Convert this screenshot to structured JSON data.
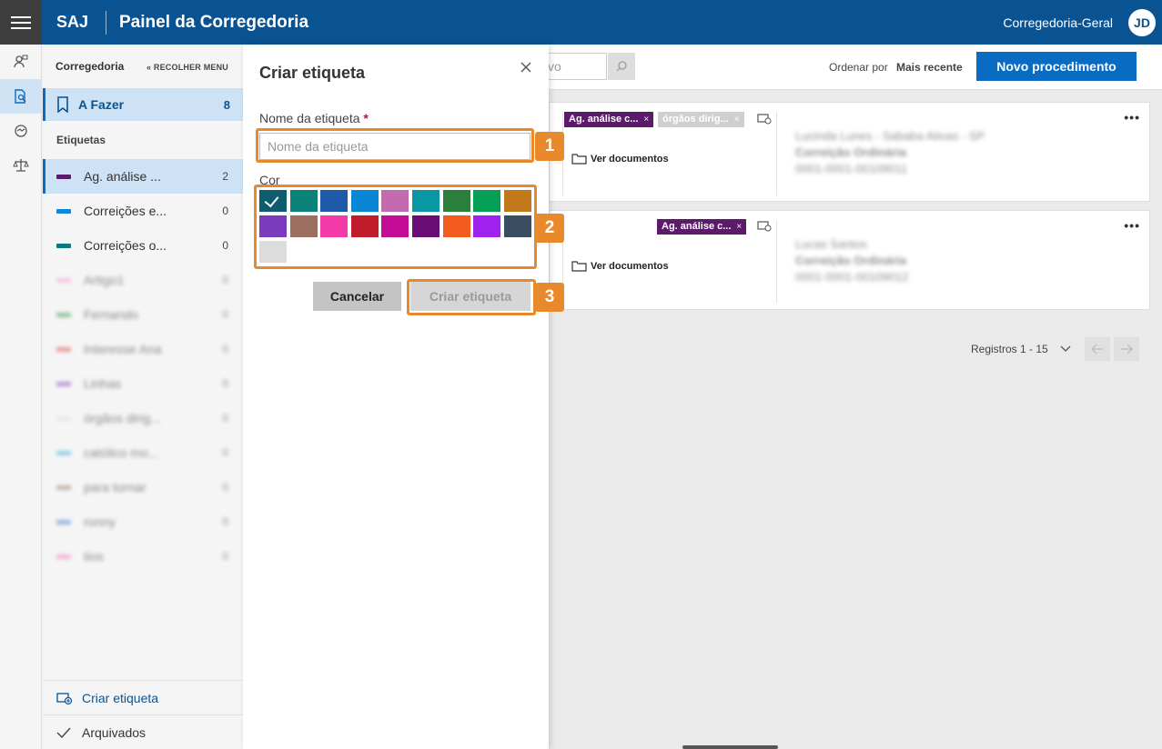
{
  "header": {
    "brand": "SAJ",
    "title": "Painel da Corregedoria",
    "user_name": "Corregedoria-Geral",
    "avatar_initials": "JD"
  },
  "sidebar": {
    "title": "Corregedoria",
    "collapse_label": "RECOLHER MENU",
    "afazer": {
      "label": "A Fazer",
      "count": "8"
    },
    "section_label": "Etiquetas",
    "tags": [
      {
        "label": "Ag. análise ...",
        "count": "2",
        "color": "#5c1a6b"
      },
      {
        "label": "Correições e...",
        "count": "0",
        "color": "#0a8ad6"
      },
      {
        "label": "Correições o...",
        "count": "0",
        "color": "#0a7a80"
      }
    ],
    "blurred_tags": [
      {
        "label": "Artigo1",
        "count": "0",
        "color": "#f5a0d0"
      },
      {
        "label": "Fernando",
        "count": "0",
        "color": "#3aa050"
      },
      {
        "label": "Interesse Ana",
        "count": "0",
        "color": "#e05050"
      },
      {
        "label": "Linhas",
        "count": "0",
        "color": "#9050c0"
      },
      {
        "label": "órgãos dirig...",
        "count": "0",
        "color": "#dddddd"
      },
      {
        "label": "católico mo...",
        "count": "0",
        "color": "#40b0e8"
      },
      {
        "label": "para tornar",
        "count": "0",
        "color": "#a08070"
      },
      {
        "label": "ronny",
        "count": "0",
        "color": "#5080d0"
      },
      {
        "label": "tios",
        "count": "0",
        "color": "#f080c0"
      }
    ],
    "create_label": "Criar etiqueta",
    "archived_label": "Arquivados"
  },
  "toolbar": {
    "search_value": "vo",
    "order_label": "Ordenar por",
    "order_value": "Mais recente",
    "new_button": "Novo procedimento"
  },
  "cards": [
    {
      "chips": [
        {
          "label": "Ag. análise c...",
          "color": "#5c1a6b"
        },
        {
          "label": "órgãos dirig...",
          "color": "#cfcfcf"
        }
      ],
      "docs_label": "Ver documentos",
      "blur_lines": [
        "Lucinda Lunes - Sababa Ativas - SP",
        "Correição Ordinária",
        "0001-0001-00109011"
      ]
    },
    {
      "chips": [
        {
          "label": "Ag. análise c...",
          "color": "#5c1a6b"
        }
      ],
      "docs_label": "Ver documentos",
      "blur_lines": [
        "Lucas Santos",
        "Correição Ordinária",
        "0001-0001-00109012"
      ]
    }
  ],
  "pager": {
    "label": "Registros 1 - 15"
  },
  "dialog": {
    "title": "Criar etiqueta",
    "name_label": "Nome da etiqueta",
    "required_mark": "*",
    "name_placeholder": "Nome da etiqueta",
    "name_value": "",
    "color_label": "Cor",
    "colors": [
      "#0e5c6e",
      "#0b8277",
      "#1e5aa8",
      "#0a86d4",
      "#c46bb0",
      "#0897a3",
      "#2b7f3a",
      "#05a055",
      "#c0781b",
      "#7a3bbc",
      "#9c6f60",
      "#f23aa8",
      "#c11c2b",
      "#c40d96",
      "#6a0d74",
      "#f35a1e",
      "#a022ee",
      "#3a4e62",
      "#dcdcdc"
    ],
    "selected_color_index": 0,
    "cancel_label": "Cancelar",
    "create_label": "Criar etiqueta"
  },
  "callouts": [
    "1",
    "2",
    "3"
  ],
  "accent_color": "#e8892b"
}
